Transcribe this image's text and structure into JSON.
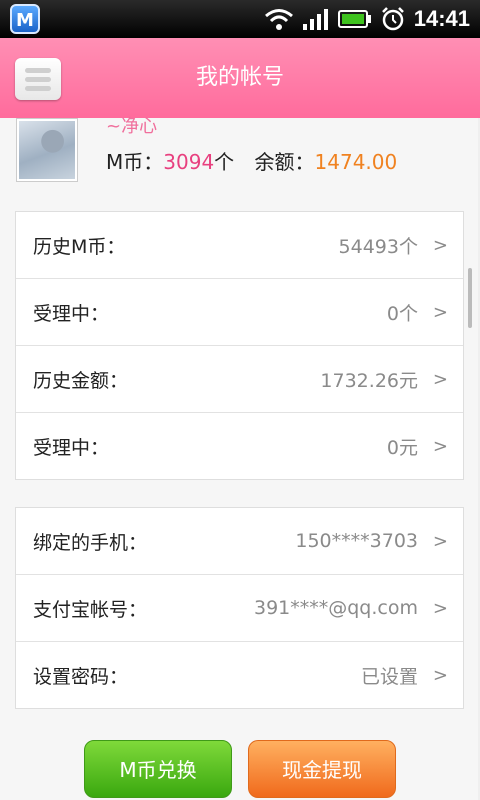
{
  "status_bar": {
    "app_icon_letter": "M",
    "time": "14:41",
    "icons": [
      "wifi-icon",
      "signal-icon",
      "battery-icon",
      "alarm-icon"
    ]
  },
  "header": {
    "title": "我的帐号",
    "menu_icon": "hamburger-icon"
  },
  "profile": {
    "nickname": "~净心",
    "m_coin_label": "M币：",
    "m_coin_value": "3094",
    "m_coin_unit": "个",
    "balance_label": "余额：",
    "balance_value": "1474.00"
  },
  "stats": [
    {
      "label": "历史M币：",
      "value": "54493个",
      "arrow": ">"
    },
    {
      "label": "受理中：",
      "value": "0个",
      "arrow": ">"
    },
    {
      "label": "历史金额：",
      "value": "1732.26元",
      "arrow": ">"
    },
    {
      "label": "受理中：",
      "value": "0元",
      "arrow": ">"
    }
  ],
  "account": [
    {
      "label": "绑定的手机：",
      "value": "150****3703",
      "arrow": ">"
    },
    {
      "label": "支付宝帐号：",
      "value": "391****@qq.com",
      "arrow": ">"
    },
    {
      "label": "设置密码：",
      "value": "已设置",
      "arrow": ">"
    }
  ],
  "actions": {
    "exchange_label": "M币兑换",
    "withdraw_label": "现金提现"
  },
  "colors": {
    "header_pink": "#ff6b9c",
    "coin_pink": "#e8407f",
    "balance_orange": "#f08220",
    "button_green": "#3aa80f",
    "button_orange": "#f06a1c"
  }
}
